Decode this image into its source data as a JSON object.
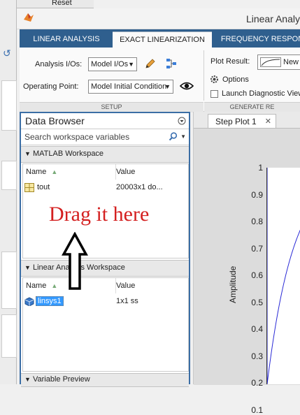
{
  "window": {
    "title": "Linear Analy"
  },
  "background": {
    "reset_label": "Reset"
  },
  "ribbon": {
    "tabs": [
      {
        "label": "LINEAR ANALYSIS"
      },
      {
        "label": "EXACT LINEARIZATION"
      },
      {
        "label": "FREQUENCY RESPON"
      }
    ],
    "analysis_ios_label": "Analysis I/Os:",
    "analysis_ios_value": "Model I/Os",
    "operating_point_label": "Operating Point:",
    "operating_point_value": "Model Initial Condition",
    "plot_result_label": "Plot Result:",
    "plot_result_value": "New",
    "options_label": "Options",
    "launch_diagnostic_label": "Launch Diagnostic View",
    "group_setup": "SETUP",
    "group_generate": "GENERATE RE"
  },
  "data_browser": {
    "title": "Data Browser",
    "search_placeholder": "Search workspace variables",
    "matlab_workspace": {
      "label": "MATLAB Workspace",
      "col_name": "Name",
      "col_value": "Value",
      "rows": [
        {
          "name": "tout",
          "value": "20003x1 do..."
        }
      ]
    },
    "linear_workspace": {
      "label": "Linear Analysis Workspace",
      "col_name": "Name",
      "col_value": "Value",
      "rows": [
        {
          "name": "linsys1",
          "value": "1x1 ss"
        }
      ]
    },
    "variable_preview_label": "Variable Preview"
  },
  "plot": {
    "tab_label": "Step Plot 1",
    "ylabel": "Amplitude",
    "yticks": [
      "1",
      "0.9",
      "0.8",
      "0.7",
      "0.6",
      "0.5",
      "0.4",
      "0.3",
      "0.2",
      "0.1"
    ]
  },
  "annotation": {
    "text": "Drag it here",
    "color": "#d42020"
  }
}
